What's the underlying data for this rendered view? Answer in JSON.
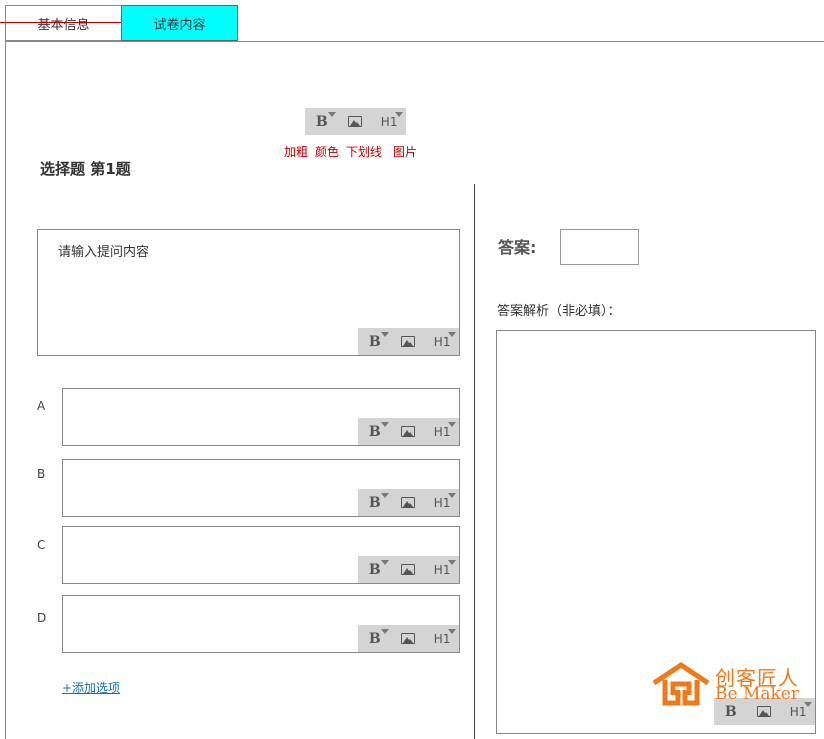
{
  "tabs": [
    {
      "label": "基本信息"
    },
    {
      "label": "试卷内容"
    }
  ],
  "toolbar": {
    "bold": "B",
    "heading": "H1"
  },
  "legend": {
    "bold": "加粗",
    "color": "颜色",
    "underline": "下划线",
    "image": "图片"
  },
  "question": {
    "title": "选择题 第1题",
    "placeholder": "请输入提问内容",
    "options": [
      {
        "label": "A"
      },
      {
        "label": "B"
      },
      {
        "label": "C"
      },
      {
        "label": "D"
      }
    ],
    "add_option": "+添加选项"
  },
  "answer": {
    "label": "答案:",
    "analysis_label": "答案解析（非必填）："
  },
  "logo": {
    "cn": "创客匠人",
    "en": "Be Maker"
  },
  "colors": {
    "active_tab": "#00ffff",
    "legend_red": "#c00000",
    "link_blue": "#1a6fb5",
    "logo_orange": "#f07a1a",
    "toolbar_gray": "#d4d4d4"
  }
}
